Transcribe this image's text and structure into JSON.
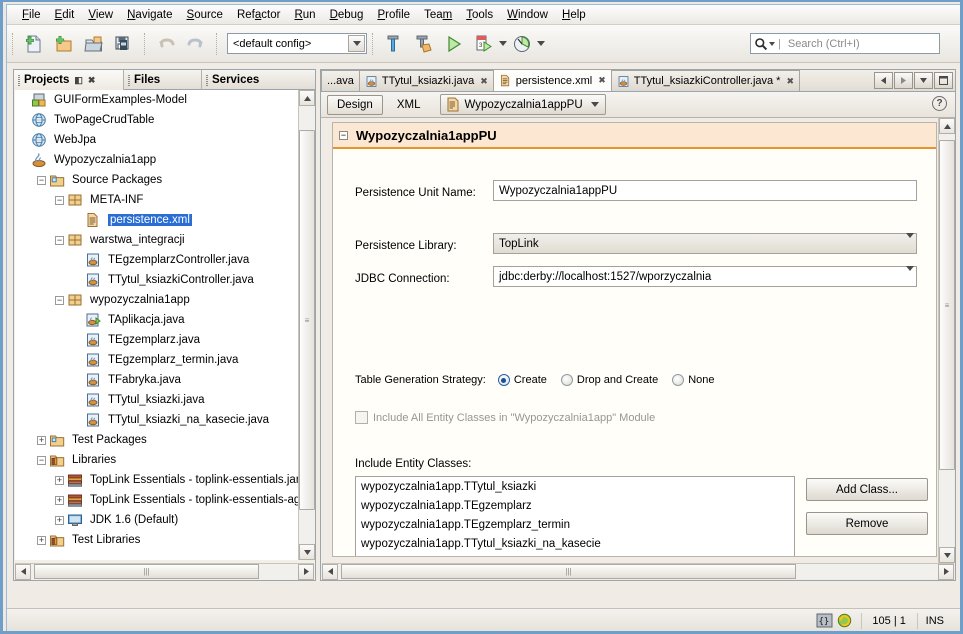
{
  "menubar": {
    "items": [
      {
        "label": "File",
        "mnemonic": "F"
      },
      {
        "label": "Edit",
        "mnemonic": "E"
      },
      {
        "label": "View",
        "mnemonic": "V"
      },
      {
        "label": "Navigate",
        "mnemonic": "N"
      },
      {
        "label": "Source",
        "mnemonic": "S"
      },
      {
        "label": "Refactor",
        "mnemonic": "a"
      },
      {
        "label": "Run",
        "mnemonic": "R"
      },
      {
        "label": "Debug",
        "mnemonic": "D"
      },
      {
        "label": "Profile",
        "mnemonic": "P"
      },
      {
        "label": "Team",
        "mnemonic": "m"
      },
      {
        "label": "Tools",
        "mnemonic": "T"
      },
      {
        "label": "Window",
        "mnemonic": "W"
      },
      {
        "label": "Help",
        "mnemonic": "H"
      }
    ]
  },
  "toolbar": {
    "buttons": [
      {
        "name": "new-file-icon",
        "tooltip": "New File"
      },
      {
        "name": "new-project-icon",
        "tooltip": "New Project"
      },
      {
        "name": "open-project-icon",
        "tooltip": "Open Project"
      },
      {
        "name": "save-all-icon",
        "tooltip": "Save All"
      },
      {
        "name": "undo-icon",
        "tooltip": "Undo",
        "enabled": false
      },
      {
        "name": "redo-icon",
        "tooltip": "Redo",
        "enabled": false
      },
      {
        "name": "build-icon",
        "tooltip": "Build Project"
      },
      {
        "name": "clean-build-icon",
        "tooltip": "Clean and Build Project"
      },
      {
        "name": "run-icon",
        "tooltip": "Run Project"
      },
      {
        "name": "debug-icon",
        "tooltip": "Debug Project"
      },
      {
        "name": "profile-icon",
        "tooltip": "Profile Project"
      }
    ],
    "config_combo_value": "<default config>"
  },
  "search": {
    "placeholder": "Search (Ctrl+I)",
    "icon": "search-icon"
  },
  "left_panel": {
    "tabs": [
      {
        "label": "Projects",
        "active": true
      },
      {
        "label": "Files",
        "active": false
      },
      {
        "label": "Services",
        "active": false
      }
    ],
    "tab_buttons": [
      "minimize-window-icon",
      "close-window-icon"
    ],
    "tree": [
      {
        "indent": 0,
        "expander": "",
        "icon": "project-model-icon",
        "label": "GUIFormExamples-Model",
        "selected": false
      },
      {
        "indent": 0,
        "expander": "",
        "icon": "project-web-icon",
        "label": "TwoPageCrudTable",
        "selected": false
      },
      {
        "indent": 0,
        "expander": "",
        "icon": "project-web-icon",
        "label": "WebJpa",
        "selected": false
      },
      {
        "indent": 0,
        "expander": "",
        "icon": "project-java-icon",
        "label": "Wypozyczalnia1app",
        "selected": false
      },
      {
        "indent": 1,
        "expander": "-",
        "icon": "source-packages-icon",
        "label": "Source Packages",
        "selected": false
      },
      {
        "indent": 2,
        "expander": "-",
        "icon": "package-icon",
        "label": "META-INF",
        "selected": false
      },
      {
        "indent": 3,
        "expander": "",
        "icon": "xml-file-icon",
        "label": "persistence.xml",
        "selected": true
      },
      {
        "indent": 2,
        "expander": "-",
        "icon": "package-icon",
        "label": "warstwa_integracji",
        "selected": false
      },
      {
        "indent": 3,
        "expander": "",
        "icon": "java-class-icon",
        "label": "TEgzemplarzController.java",
        "selected": false
      },
      {
        "indent": 3,
        "expander": "",
        "icon": "java-class-icon",
        "label": "TTytul_ksiazkiController.java",
        "selected": false
      },
      {
        "indent": 2,
        "expander": "-",
        "icon": "package-icon",
        "label": "wypozyczalnia1app",
        "selected": false
      },
      {
        "indent": 3,
        "expander": "",
        "icon": "java-main-class-icon",
        "label": "TAplikacja.java",
        "selected": false
      },
      {
        "indent": 3,
        "expander": "",
        "icon": "java-class-icon",
        "label": "TEgzemplarz.java",
        "selected": false
      },
      {
        "indent": 3,
        "expander": "",
        "icon": "java-class-icon",
        "label": "TEgzemplarz_termin.java",
        "selected": false
      },
      {
        "indent": 3,
        "expander": "",
        "icon": "java-class-icon",
        "label": "TFabryka.java",
        "selected": false
      },
      {
        "indent": 3,
        "expander": "",
        "icon": "java-class-icon",
        "label": "TTytul_ksiazki.java",
        "selected": false
      },
      {
        "indent": 3,
        "expander": "",
        "icon": "java-class-icon",
        "label": "TTytul_ksiazki_na_kasecie.java",
        "selected": false
      },
      {
        "indent": 1,
        "expander": "+",
        "icon": "test-packages-icon",
        "label": "Test Packages",
        "selected": false
      },
      {
        "indent": 1,
        "expander": "-",
        "icon": "libraries-icon",
        "label": "Libraries",
        "selected": false
      },
      {
        "indent": 2,
        "expander": "+",
        "icon": "jar-icon",
        "label": "TopLink Essentials - toplink-essentials.jar",
        "selected": false
      },
      {
        "indent": 2,
        "expander": "+",
        "icon": "jar-icon",
        "label": "TopLink Essentials - toplink-essentials-agent.j",
        "selected": false
      },
      {
        "indent": 2,
        "expander": "+",
        "icon": "jdk-icon",
        "label": "JDK 1.6 (Default)",
        "selected": false
      },
      {
        "indent": 1,
        "expander": "+",
        "icon": "libraries-icon",
        "label": "Test Libraries",
        "selected": false
      }
    ]
  },
  "editor": {
    "tabs": [
      {
        "label": "...ava",
        "icon": "",
        "modified": false,
        "active": false,
        "closable": false
      },
      {
        "label": "TTytul_ksiazki.java",
        "icon": "java-class-icon",
        "modified": false,
        "active": false,
        "closable": true
      },
      {
        "label": "persistence.xml",
        "icon": "xml-file-icon",
        "modified": false,
        "active": true,
        "closable": true
      },
      {
        "label": "TTytul_ksiazkiController.java *",
        "icon": "java-class-icon",
        "modified": true,
        "active": false,
        "closable": true
      }
    ],
    "tab_nav_buttons": [
      "scroll-tabs-left-icon",
      "scroll-tabs-right-icon",
      "tab-list-dropdown-icon",
      "maximize-window-icon"
    ],
    "view_toggle": [
      {
        "label": "Design",
        "active": true
      },
      {
        "label": "XML",
        "active": false
      }
    ],
    "persistence_unit_combo": "Wypozyczalnia1appPU",
    "help_button": "help-icon"
  },
  "form": {
    "header_title": "Wypozyczalnia1appPU",
    "persistence_unit_name": {
      "label": "Persistence Unit Name:",
      "value": "Wypozyczalnia1appPU"
    },
    "persistence_library": {
      "label": "Persistence Library:",
      "value": "TopLink"
    },
    "jdbc_connection": {
      "label": "JDBC Connection:",
      "value": "jdbc:derby://localhost:1527/wporzyczalnia"
    },
    "table_generation": {
      "label": "Table Generation Strategy:",
      "options": [
        {
          "label": "Create",
          "checked": true
        },
        {
          "label": "Drop and Create",
          "checked": false
        },
        {
          "label": "None",
          "checked": false
        }
      ]
    },
    "include_all_checkbox": {
      "label": "Include All Entity Classes in \"Wypozyczalnia1app\" Module",
      "checked": false,
      "enabled": false
    },
    "include_entity_classes": {
      "label": "Include Entity Classes:",
      "items": [
        "wypozyczalnia1app.TTytul_ksiazki",
        "wypozyczalnia1app.TEgzemplarz",
        "wypozyczalnia1app.TEgzemplarz_termin",
        "wypozyczalnia1app.TTytul_ksiazki_na_kasecie"
      ]
    },
    "buttons": [
      {
        "label": "Add Class...",
        "name": "add-class-button"
      },
      {
        "label": "Remove",
        "name": "remove-button"
      }
    ]
  },
  "statusbar": {
    "icons": [
      "brace-match-icon",
      "refresh-icon"
    ],
    "caret_position": "105 | 1",
    "insert_mode": "INS"
  },
  "colors": {
    "accent_orange": "#e8922e",
    "header_bg": "#fbe7d2",
    "selection_blue": "#2a6ed4",
    "window_border": "#6f9fc8"
  }
}
